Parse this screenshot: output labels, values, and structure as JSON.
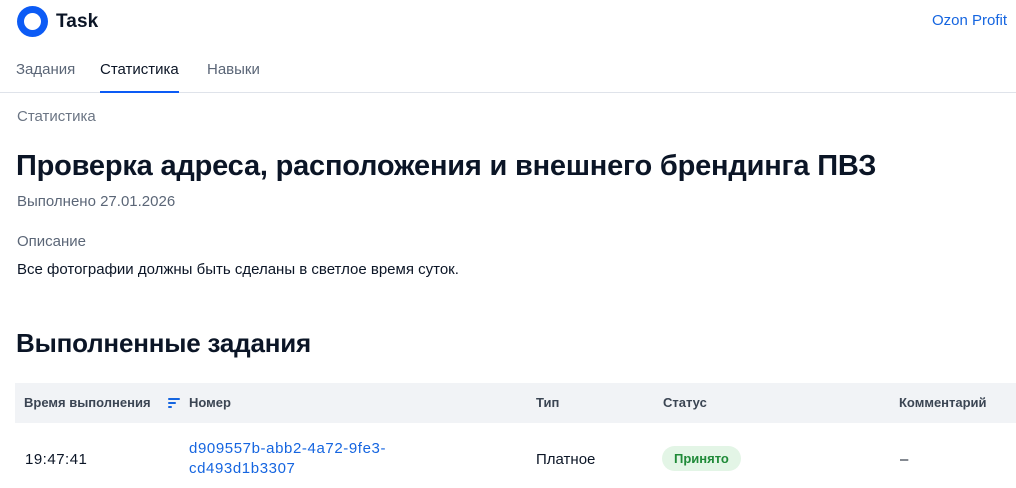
{
  "header": {
    "app_name": "Task",
    "profit_link": "Ozon Profit"
  },
  "tabs": [
    {
      "label": "Задания",
      "active": false
    },
    {
      "label": "Статистика",
      "active": true
    },
    {
      "label": "Навыки",
      "active": false
    }
  ],
  "breadcrumb": "Статистика",
  "task": {
    "title": "Проверка адреса, расположения и внешнего брендинга ПВЗ",
    "completed_date": "Выполнено 27.01.2026",
    "description_label": "Описание",
    "description": "Все фотографии должны быть сделаны в светлое время суток."
  },
  "completed_section": {
    "title": "Выполненные задания",
    "columns": [
      "Время выполнения",
      "Номер",
      "Тип",
      "Статус",
      "Комментарий"
    ],
    "rows": [
      {
        "time": "19:47:41",
        "number": "d909557b-abb2-4a72-9fe3-cd493d1b3307",
        "type": "Платное",
        "status": "Принято",
        "comment": "–"
      }
    ]
  },
  "colors": {
    "brand": "#0c5bf5",
    "link": "#1565e0",
    "status_accepted_bg": "#e3f5e6",
    "status_accepted_text": "#1f8a38"
  },
  "icons": {
    "logo": "logo-circle-icon",
    "sort": "sort-lines-icon"
  }
}
